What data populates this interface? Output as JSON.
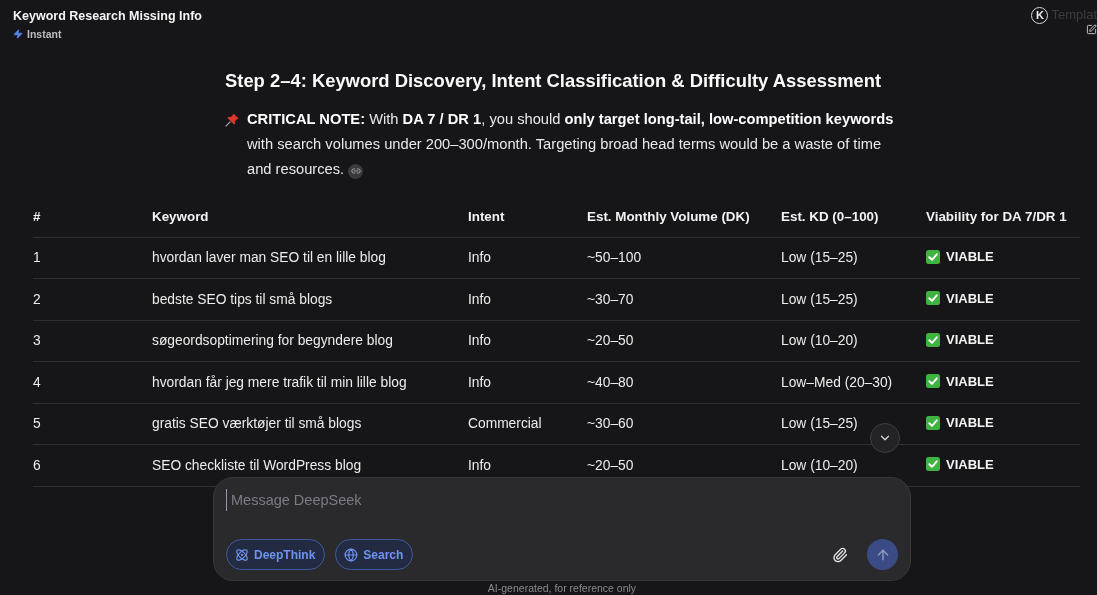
{
  "window": {
    "title": "Keyword Research Missing Info",
    "mode": "Instant"
  },
  "extension_badge": {
    "letter": "K",
    "label": "Templat"
  },
  "heading": "Step 2–4: Keyword Discovery, Intent Classification & Difficulty Assessment",
  "note": "**CRITICAL NOTE:** With **DA 7 / DR 1**, you should **only target long-tail, low-competition keywords** with search volumes under 200–300/month. Targeting broad head terms would be a waste of time and resources.",
  "table": {
    "columns": [
      "#",
      "Keyword",
      "Intent",
      "Est. Monthly Volume (DK)",
      "Est. KD (0–100)",
      "Viability for DA 7/DR 1"
    ],
    "rows": [
      {
        "cells": [
          "1",
          "hvordan laver man SEO til en lille blog",
          "Info",
          "~50–100",
          "Low (15–25)"
        ],
        "viable": true,
        "viability": "VIABLE"
      },
      {
        "cells": [
          "2",
          "bedste SEO tips til små blogs",
          "Info",
          "~30–70",
          "Low (15–25)"
        ],
        "viable": true,
        "viability": "VIABLE"
      },
      {
        "cells": [
          "3",
          "søgeordsoptimering for begyndere blog",
          "Info",
          "~20–50",
          "Low (10–20)"
        ],
        "viable": true,
        "viability": "VIABLE"
      },
      {
        "cells": [
          "4",
          "hvordan får jeg mere trafik til min lille blog",
          "Info",
          "~40–80",
          "Low–Med (20–30)"
        ],
        "viable": true,
        "viability": "VIABLE"
      },
      {
        "cells": [
          "5",
          "gratis SEO værktøjer til små blogs",
          "Commercial",
          "~30–60",
          "Low (15–25)"
        ],
        "viable": true,
        "viability": "VIABLE"
      },
      {
        "cells": [
          "6",
          "SEO checkliste til WordPress blog",
          "Info",
          "~20–50",
          "Low (10–20)"
        ],
        "viable": true,
        "viability": "VIABLE"
      }
    ]
  },
  "composer": {
    "placeholder": "Message DeepSeek",
    "toggles": [
      {
        "kind": "deepthink",
        "label": "DeepThink",
        "selected": true
      },
      {
        "kind": "search",
        "label": "Search",
        "selected": true
      }
    ],
    "send_disabled": true
  },
  "footer": "AI-generated, for reference only"
}
